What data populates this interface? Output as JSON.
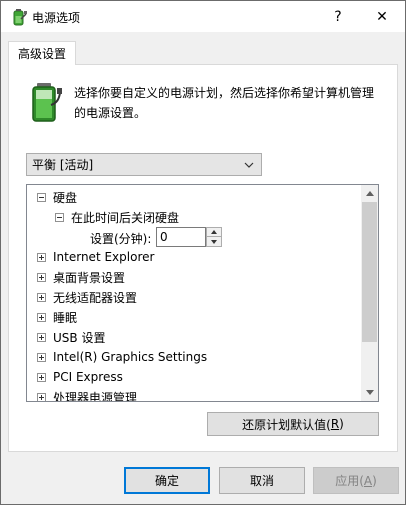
{
  "window": {
    "title": "电源选项",
    "help_label": "?",
    "close_label": "✕"
  },
  "tab": {
    "label": "高级设置"
  },
  "description": {
    "line1": "选择你要自定义的电源计划，然后选择你希望计算机管理",
    "line2": "的电源设置。"
  },
  "plan_select": {
    "value": "平衡 [活动]"
  },
  "tree": {
    "items": [
      {
        "label": "硬盘",
        "expander": "⊟"
      },
      {
        "label": "在此时间后关闭硬盘",
        "expander": "⊟"
      },
      {
        "label": "Internet Explorer",
        "expander": "⊞"
      },
      {
        "label": "桌面背景设置",
        "expander": "⊞"
      },
      {
        "label": "无线适配器设置",
        "expander": "⊞"
      },
      {
        "label": "睡眠",
        "expander": "⊞"
      },
      {
        "label": "USB 设置",
        "expander": "⊞"
      },
      {
        "label": "Intel(R) Graphics Settings",
        "expander": "⊞"
      },
      {
        "label": "PCI Express",
        "expander": "⊞"
      },
      {
        "label": "处理器电源管理",
        "expander": "⊞"
      }
    ],
    "setting_label": "设置(分钟):",
    "setting_value": "0"
  },
  "buttons": {
    "restore_text": "还原计划默认值(",
    "restore_key": "R",
    "restore_close": ")",
    "ok": "确定",
    "cancel": "取消",
    "apply_text": "应用(",
    "apply_key": "A",
    "apply_close": ")"
  },
  "colors": {
    "accent": "#0078d7",
    "battery_green": "#3fa535"
  },
  "icons": {
    "app": "battery-plug-icon",
    "scroll_up": "chevron-up-icon",
    "scroll_down": "chevron-down-icon"
  }
}
